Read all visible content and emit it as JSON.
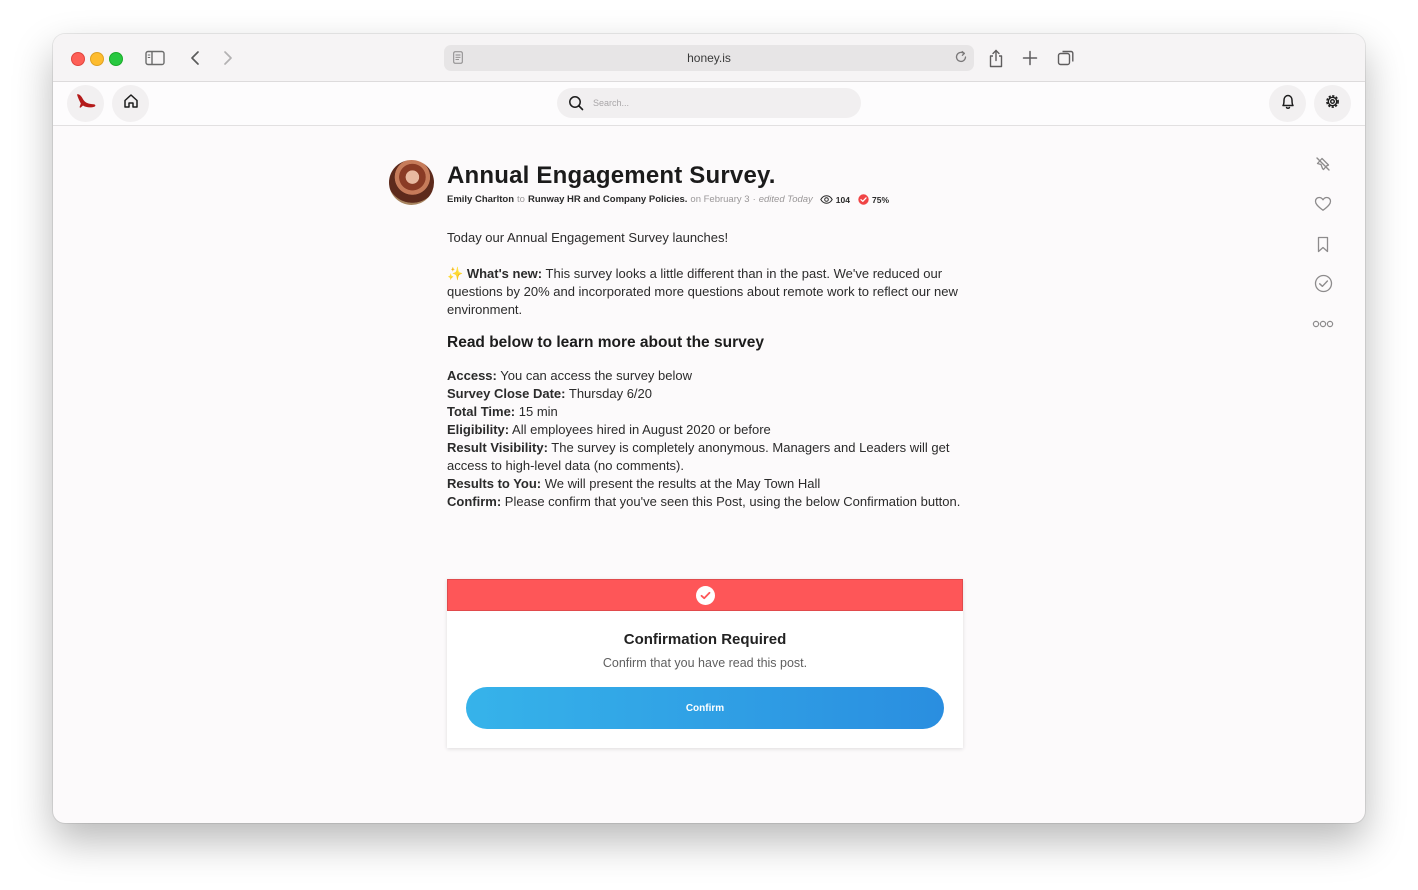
{
  "browser": {
    "url": "honey.is"
  },
  "navbar": {
    "search_placeholder": "Search..."
  },
  "post": {
    "title": "Annual Engagement Survey.",
    "author": "Emily Charlton",
    "to_word": "to",
    "channel": "Runway HR and Company Policies.",
    "date": "on February 3",
    "edited": "edited Today",
    "views": "104",
    "confirm_percent": "75%",
    "intro": "Today our Annual Engagement Survey launches!",
    "whats_new_emoji": "✨",
    "whats_new_label": "What's new:",
    "whats_new_text": "This survey looks a little different than in the past. We've reduced our questions by 20% and incorporated more questions about remote work to reflect our new environment.",
    "section_heading": "Read below to learn more about the survey",
    "details": [
      {
        "label": "Access:",
        "text": "You can access the survey below"
      },
      {
        "label": "Survey Close Date:",
        "text": "Thursday 6/20"
      },
      {
        "label": "Total Time:",
        "text": "15 min"
      },
      {
        "label": "Eligibility:",
        "text": "All employees hired in August 2020 or before"
      },
      {
        "label": "Result Visibility:",
        "text": "The survey is completely anonymous. Managers and Leaders will get access to high-level data (no comments)."
      },
      {
        "label": "Results to You:",
        "text": "We will present the results at the May Town Hall"
      },
      {
        "label": "Confirm:",
        "text": "Please confirm that you've seen this Post, using the below Confirmation button."
      }
    ]
  },
  "confirmation": {
    "title": "Confirmation Required",
    "subtitle": "Confirm that you have read this post.",
    "button_label": "Confirm"
  },
  "colors": {
    "banner_red": "#fe5658",
    "button_blue_start": "#36b3ea",
    "button_blue_end": "#2a8ee0",
    "logo_red": "#b41a1a"
  }
}
